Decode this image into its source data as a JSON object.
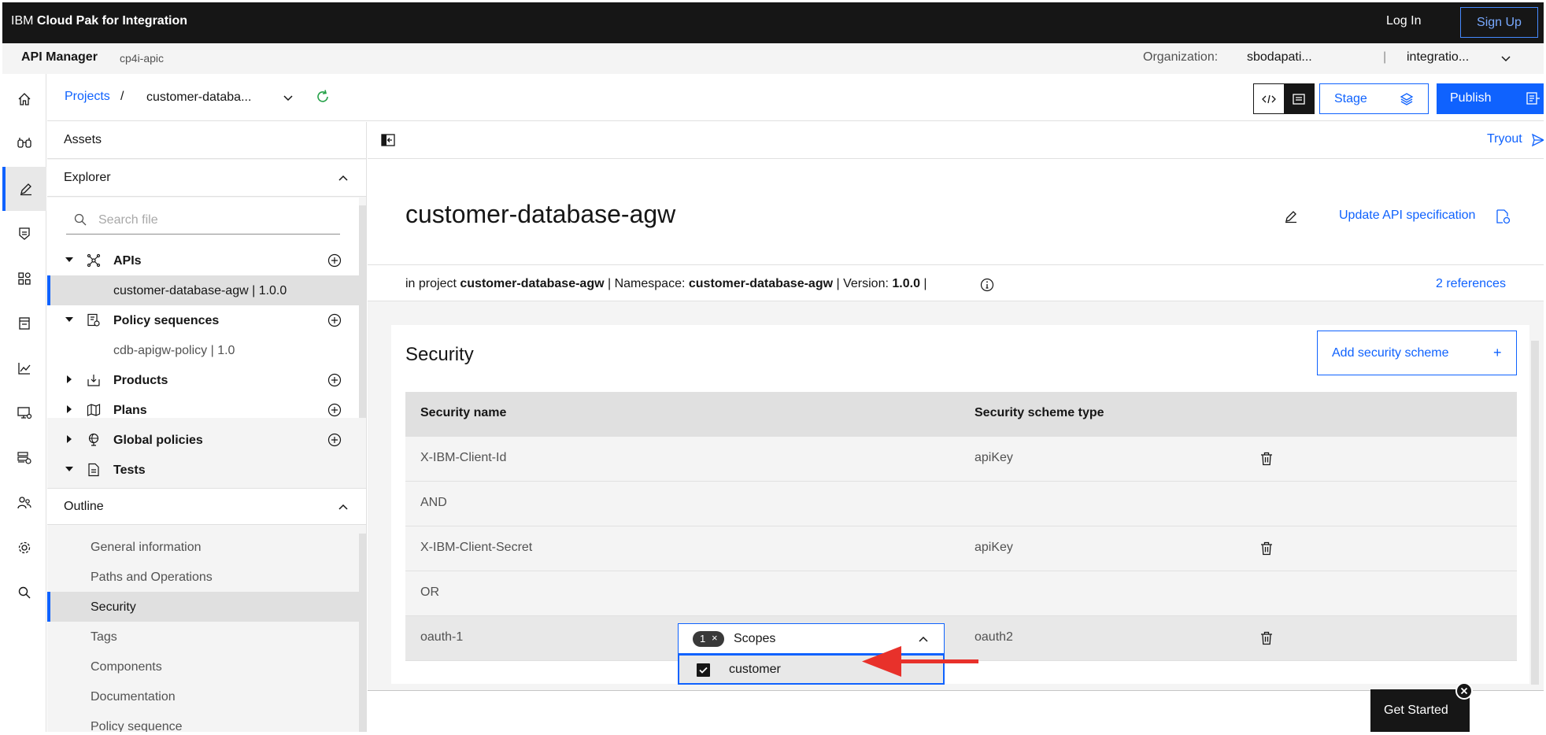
{
  "topbar": {
    "brand_prefix": "IBM ",
    "brand_bold": "Cloud Pak for Integration",
    "login": "Log In",
    "signup": "Sign Up"
  },
  "subbar": {
    "app": "API Manager",
    "instance": "cp4i-apic",
    "org_label": "Organization:",
    "org_value": "sbodapati...",
    "separator": "|",
    "catalog_value": "integratio..."
  },
  "rail": {
    "icons": [
      "home-icon",
      "explore-icon",
      "edit-icon",
      "policy-icon",
      "apps-icon",
      "catalog-icon",
      "analytics-icon",
      "monitor-icon",
      "resources-icon",
      "members-icon",
      "settings-icon",
      "search-icon"
    ],
    "active": "edit-icon"
  },
  "breadcrumb": {
    "projects": "Projects",
    "separator": "/",
    "current": "customer-databa..."
  },
  "toolbar": {
    "stage": "Stage",
    "publish": "Publish"
  },
  "explorer": {
    "assets": "Assets",
    "title": "Explorer",
    "search_placeholder": "Search file",
    "tree": [
      {
        "label": "APIs",
        "expanded": true
      },
      {
        "label": "customer-database-agw | 1.0.0",
        "selected": true
      },
      {
        "label": "Policy sequences",
        "expanded": true
      },
      {
        "label": "cdb-apigw-policy | 1.0"
      },
      {
        "label": "Products",
        "expanded": false
      },
      {
        "label": "Plans",
        "expanded": false
      },
      {
        "label": "Global policies",
        "expanded": false
      },
      {
        "label": "Tests",
        "expanded": true
      }
    ],
    "outline_title": "Outline",
    "outline": [
      "General information",
      "Paths and Operations",
      "Security",
      "Tags",
      "Components",
      "Documentation",
      "Policy sequence"
    ],
    "outline_selected": "Security"
  },
  "main": {
    "tryout": "Tryout",
    "api_title": "customer-database-agw",
    "update_spec": "Update API specification",
    "info": {
      "in_project": "in project",
      "project": "customer-database-agw",
      "namespace_label": "| Namespace:",
      "namespace": "customer-database-agw",
      "version_label": "| Version:",
      "version": "1.0.0",
      "trail": "|"
    },
    "references": "2 references",
    "security": {
      "title": "Security",
      "add_button": "Add security scheme",
      "add_plus": "+",
      "col_name": "Security name",
      "col_type": "Security scheme type",
      "rows": [
        {
          "name": "X-IBM-Client-Id",
          "type": "apiKey"
        },
        {
          "name": "AND",
          "type": ""
        },
        {
          "name": "X-IBM-Client-Secret",
          "type": "apiKey"
        },
        {
          "name": "OR",
          "type": ""
        },
        {
          "name": "oauth-1",
          "type": "oauth2"
        }
      ],
      "scopes": {
        "count": "1",
        "clear": "×",
        "label": "Scopes",
        "option": "customer",
        "option_checked": true
      }
    }
  },
  "get_started": "Get Started",
  "colors": {
    "accent": "#0f62fe",
    "topbar": "#161616",
    "annotation_arrow": "#e8312b"
  }
}
